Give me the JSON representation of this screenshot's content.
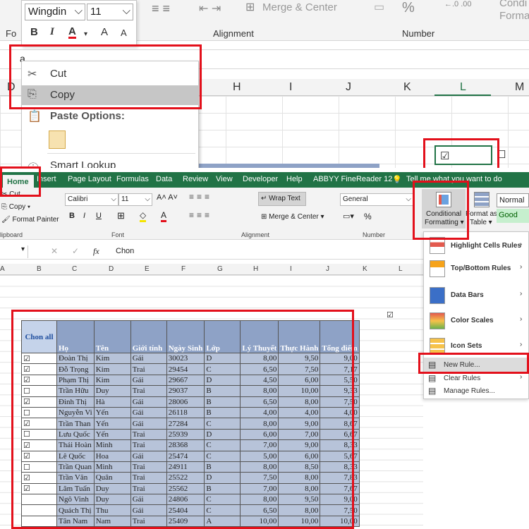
{
  "top_screenshot": {
    "ribbon": {
      "font_name": "Wingdin",
      "font_size": "11",
      "groups": [
        "Alignment",
        "Number"
      ],
      "merge_center_label": "Merge & Center",
      "percent_glyph": "%",
      "cond_label_1": "Condi",
      "cond_label_2": "Forma",
      "partial_font_label": "Fo"
    },
    "minibar_buttons": [
      "B",
      "I",
      "A",
      "A",
      "A"
    ],
    "context_menu": {
      "cut": "Cut",
      "copy": "Copy",
      "paste_options": "Paste Options:",
      "smart_lookup": "Smart Lookup"
    },
    "columns": [
      "D",
      "H",
      "I",
      "J",
      "K",
      "L",
      "M"
    ],
    "checkbox_cell_glyph": "☑",
    "unchecked_glyph": "☐"
  },
  "bottom_screenshot": {
    "tabs": [
      "Home",
      "Insert",
      "Page Layout",
      "Formulas",
      "Data",
      "Review",
      "View",
      "Developer",
      "Help",
      "ABBYY FineReader 12"
    ],
    "tell_me": "Tell me what you want to do",
    "clipboard": {
      "cut": "Cut",
      "copy": "Copy",
      "format_painter": "Format Painter",
      "group": "lipboard"
    },
    "font": {
      "name": "Calibri",
      "size": "11",
      "group": "Font"
    },
    "alignment": {
      "wrap_text": "Wrap Text",
      "merge_center": "Merge & Center",
      "group": "Alignment"
    },
    "number": {
      "format": "General",
      "group": "Number",
      "percent": "%"
    },
    "conditional_formatting": {
      "line1": "Conditional",
      "line2": "Formatting"
    },
    "format_as_table": {
      "line1": "Format as",
      "line2": "Table"
    },
    "styles": {
      "normal": "Normal",
      "good": "Good"
    },
    "formula_bar": {
      "fx": "fx",
      "value": "Chon"
    },
    "columns": [
      "A",
      "B",
      "C",
      "D",
      "E",
      "F",
      "G",
      "H",
      "I",
      "J",
      "K",
      "L"
    ],
    "cf_menu": [
      {
        "label": "Highlight Cells Rules",
        "arrow": "›"
      },
      {
        "label": "Top/Bottom Rules",
        "arrow": "›"
      },
      {
        "label": "Data Bars",
        "arrow": "›"
      },
      {
        "label": "Color Scales",
        "arrow": "›"
      },
      {
        "label": "Icon Sets",
        "arrow": "›"
      },
      {
        "label": "New Rule..."
      },
      {
        "label": "Clear Rules",
        "arrow": "›"
      },
      {
        "label": "Manage Rules..."
      }
    ],
    "table_headers": [
      "Chon all",
      "Họ",
      "Tên",
      "Giới tính",
      "Ngày Sinh",
      "Lớp",
      "Lý Thuyết",
      "Thực Hành",
      "Tổng điểm"
    ],
    "rows": [
      [
        "☑",
        "Đoàn Thị",
        "Kim",
        "Gái",
        "30023",
        "D",
        "8,00",
        "9,50",
        "9,00"
      ],
      [
        "☑",
        "Đỗ Trọng",
        "Kim",
        "Trai",
        "29454",
        "C",
        "6,50",
        "7,50",
        "7,17"
      ],
      [
        "☑",
        "Phạm Thị",
        "Kim",
        "Gái",
        "29667",
        "D",
        "4,50",
        "6,00",
        "5,50"
      ],
      [
        "☐",
        "Trần Hữu",
        "Duy",
        "Trai",
        "29037",
        "B",
        "8,00",
        "10,00",
        "9,33"
      ],
      [
        "☑",
        "Đinh Thị",
        "Hà",
        "Gái",
        "28006",
        "B",
        "6,50",
        "8,00",
        "7,50"
      ],
      [
        "☐",
        "Nguyễn Vi",
        "Yến",
        "Gái",
        "26118",
        "B",
        "4,00",
        "4,00",
        "4,00"
      ],
      [
        "☑",
        "Trần Than",
        "Yến",
        "Gái",
        "27284",
        "C",
        "8,00",
        "9,00",
        "8,67"
      ],
      [
        "☐",
        "Lưu Quốc",
        "Yến",
        "Trai",
        "25939",
        "D",
        "6,00",
        "7,00",
        "6,67"
      ],
      [
        "☑",
        "Thái Hoàn",
        "Minh",
        "Trai",
        "28368",
        "C",
        "7,00",
        "9,00",
        "8,33"
      ],
      [
        "☑",
        "Lê Quốc",
        "Hoa",
        "Gái",
        "25474",
        "C",
        "5,00",
        "6,00",
        "5,67"
      ],
      [
        "☐",
        "Trần Quan",
        "Minh",
        "Trai",
        "24911",
        "B",
        "8,00",
        "8,50",
        "8,33"
      ],
      [
        "☑",
        "Trần Văn",
        "Quân",
        "Trai",
        "25522",
        "D",
        "7,50",
        "8,00",
        "7,83"
      ],
      [
        "☑",
        "Lâm Tuấn",
        "Duy",
        "Trai",
        "25562",
        "B",
        "7,00",
        "8,00",
        "7,67"
      ],
      [
        "",
        "Ngô Vinh",
        "Duy",
        "Gái",
        "24806",
        "C",
        "8,00",
        "9,50",
        "9,00"
      ],
      [
        "",
        "Quách Thị",
        "Thu",
        "Gái",
        "25404",
        "C",
        "6,50",
        "8,00",
        "7,50"
      ],
      [
        "",
        "Tân Nam",
        "Nam",
        "Trai",
        "25409",
        "A",
        "10,00",
        "10,00",
        "10,00"
      ]
    ],
    "outside_checkbox": "☑"
  }
}
